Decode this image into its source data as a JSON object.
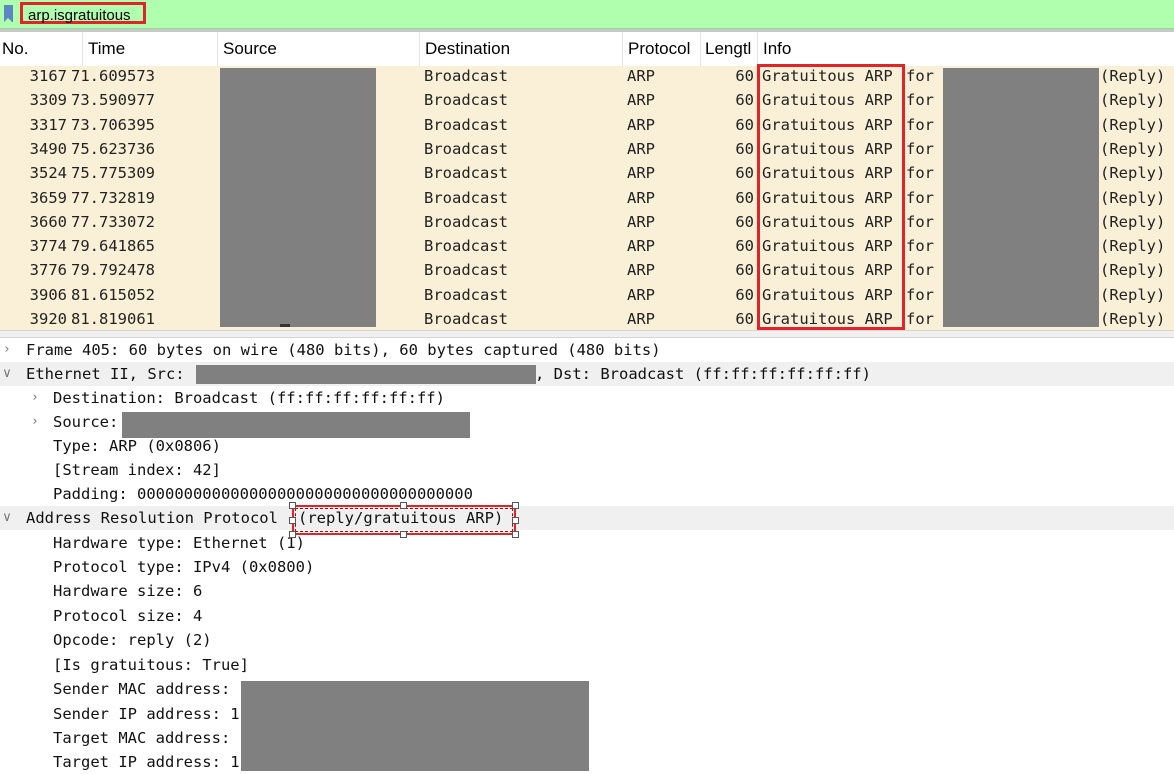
{
  "filter": {
    "value": "arp.isgratuitous"
  },
  "columns": [
    "No.",
    "Time",
    "Source",
    "Destination",
    "Protocol",
    "Lengtl",
    "Info"
  ],
  "packets": [
    {
      "no": "3167",
      "time": "71.609573",
      "destination": "Broadcast",
      "protocol": "ARP",
      "length": "60",
      "info": "Gratuitous ARP",
      "for": "for",
      "reply": "(Reply)"
    },
    {
      "no": "3309",
      "time": "73.590977",
      "destination": "Broadcast",
      "protocol": "ARP",
      "length": "60",
      "info": "Gratuitous ARP",
      "for": "for",
      "reply": "(Reply)"
    },
    {
      "no": "3317",
      "time": "73.706395",
      "destination": "Broadcast",
      "protocol": "ARP",
      "length": "60",
      "info": "Gratuitous ARP",
      "for": "for",
      "reply": "(Reply)"
    },
    {
      "no": "3490",
      "time": "75.623736",
      "destination": "Broadcast",
      "protocol": "ARP",
      "length": "60",
      "info": "Gratuitous ARP",
      "for": "for",
      "reply": "(Reply)"
    },
    {
      "no": "3524",
      "time": "75.775309",
      "destination": "Broadcast",
      "protocol": "ARP",
      "length": "60",
      "info": "Gratuitous ARP",
      "for": "for",
      "reply": "(Reply)"
    },
    {
      "no": "3659",
      "time": "77.732819",
      "destination": "Broadcast",
      "protocol": "ARP",
      "length": "60",
      "info": "Gratuitous ARP",
      "for": "for",
      "reply": "(Reply)"
    },
    {
      "no": "3660",
      "time": "77.733072",
      "destination": "Broadcast",
      "protocol": "ARP",
      "length": "60",
      "info": "Gratuitous ARP",
      "for": "for",
      "reply": "(Reply)"
    },
    {
      "no": "3774",
      "time": "79.641865",
      "destination": "Broadcast",
      "protocol": "ARP",
      "length": "60",
      "info": "Gratuitous ARP",
      "for": "for",
      "reply": "(Reply)"
    },
    {
      "no": "3776",
      "time": "79.792478",
      "destination": "Broadcast",
      "protocol": "ARP",
      "length": "60",
      "info": "Gratuitous ARP",
      "for": "for",
      "reply": "(Reply)"
    },
    {
      "no": "3906",
      "time": "81.615052",
      "destination": "Broadcast",
      "protocol": "ARP",
      "length": "60",
      "info": "Gratuitous ARP",
      "for": "for",
      "reply": "(Reply)"
    },
    {
      "no": "3920",
      "time": "81.819061",
      "destination": "Broadcast",
      "protocol": "ARP",
      "length": "60",
      "info": "Gratuitous ARP",
      "for": "for",
      "reply": "(Reply)"
    }
  ],
  "details": {
    "frame": "Frame 405: 60 bytes on wire (480 bits), 60 bytes captured (480 bits)",
    "ethernet_prefix": "Ethernet II, Src:",
    "ethernet_suffix": ", Dst: Broadcast (ff:ff:ff:ff:ff:ff)",
    "eth_destination": "Destination: Broadcast (ff:ff:ff:ff:ff:ff)",
    "eth_source": "Source:",
    "eth_type": "Type: ARP (0x0806)",
    "eth_stream": "[Stream index: 42]",
    "eth_padding": "Padding: 000000000000000000000000000000000000",
    "arp_title": "Address Resolution Protocol",
    "arp_annotation": "(reply/gratuitous ARP)",
    "hw_type": "Hardware type: Ethernet (1)",
    "proto_type": "Protocol type: IPv4 (0x0800)",
    "hw_size": "Hardware size: 6",
    "proto_size": "Protocol size: 4",
    "opcode": "Opcode: reply (2)",
    "is_gratuitous": "[Is gratuitous: True]",
    "sender_mac": "Sender MAC address:",
    "sender_ip": "Sender IP address: 1",
    "target_mac": "Target MAC address:",
    "target_ip": "Target IP address: 1"
  },
  "icons": {
    "collapsed": "chevron-right-icon",
    "expanded": "chevron-down-icon",
    "bookmark": "bookmark-icon"
  },
  "colors": {
    "filter_bg": "#afffaf",
    "row_bg": "#faf0d7",
    "highlight": "#e0242a",
    "redaction": "#808080"
  }
}
